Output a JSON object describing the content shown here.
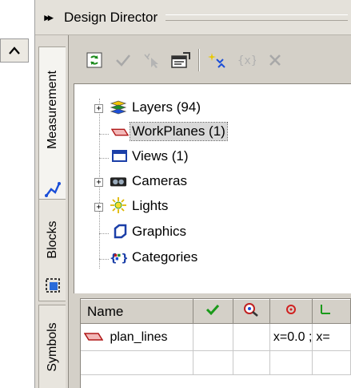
{
  "titlebar": {
    "pin_glyph": "▸▸",
    "title": "Design Director"
  },
  "vertical_tabs": [
    {
      "label": "Measurement",
      "icon": "measurement-icon"
    },
    {
      "label": "Blocks",
      "icon": "blocks-icon"
    },
    {
      "label": "Symbols",
      "icon": "symbols-icon"
    }
  ],
  "toolbar": {
    "buttons": [
      "refresh-icon",
      "check-icon",
      "select-filter-icon",
      "properties-icon",
      "new-item-icon",
      "brackets-icon",
      "delete-icon"
    ]
  },
  "tree": {
    "items": [
      {
        "label": "Layers (94)",
        "expander": "+",
        "icon": "layers-icon",
        "selected": false
      },
      {
        "label": "WorkPlanes (1)",
        "expander": "",
        "icon": "workplane-icon",
        "selected": true
      },
      {
        "label": "Views (1)",
        "expander": "",
        "icon": "view-icon",
        "selected": false
      },
      {
        "label": "Cameras",
        "expander": "+",
        "icon": "camera-icon",
        "selected": false
      },
      {
        "label": "Lights",
        "expander": "+",
        "icon": "light-icon",
        "selected": false
      },
      {
        "label": "Graphics",
        "expander": "",
        "icon": "graphics-icon",
        "selected": false
      },
      {
        "label": "Categories",
        "expander": "",
        "icon": "categories-icon",
        "selected": false
      }
    ]
  },
  "grid": {
    "columns": [
      "Name",
      "✔",
      "🔍",
      "○",
      "⠿"
    ],
    "rows": [
      {
        "name": "plan_lines",
        "c1": "",
        "c2": "",
        "c3": "x=0.0 ;",
        "c4": "x="
      }
    ]
  },
  "colors": {
    "panel": "#d4d0c8",
    "selection": "#d9d9d9",
    "tree_bg": "#ffffff"
  }
}
